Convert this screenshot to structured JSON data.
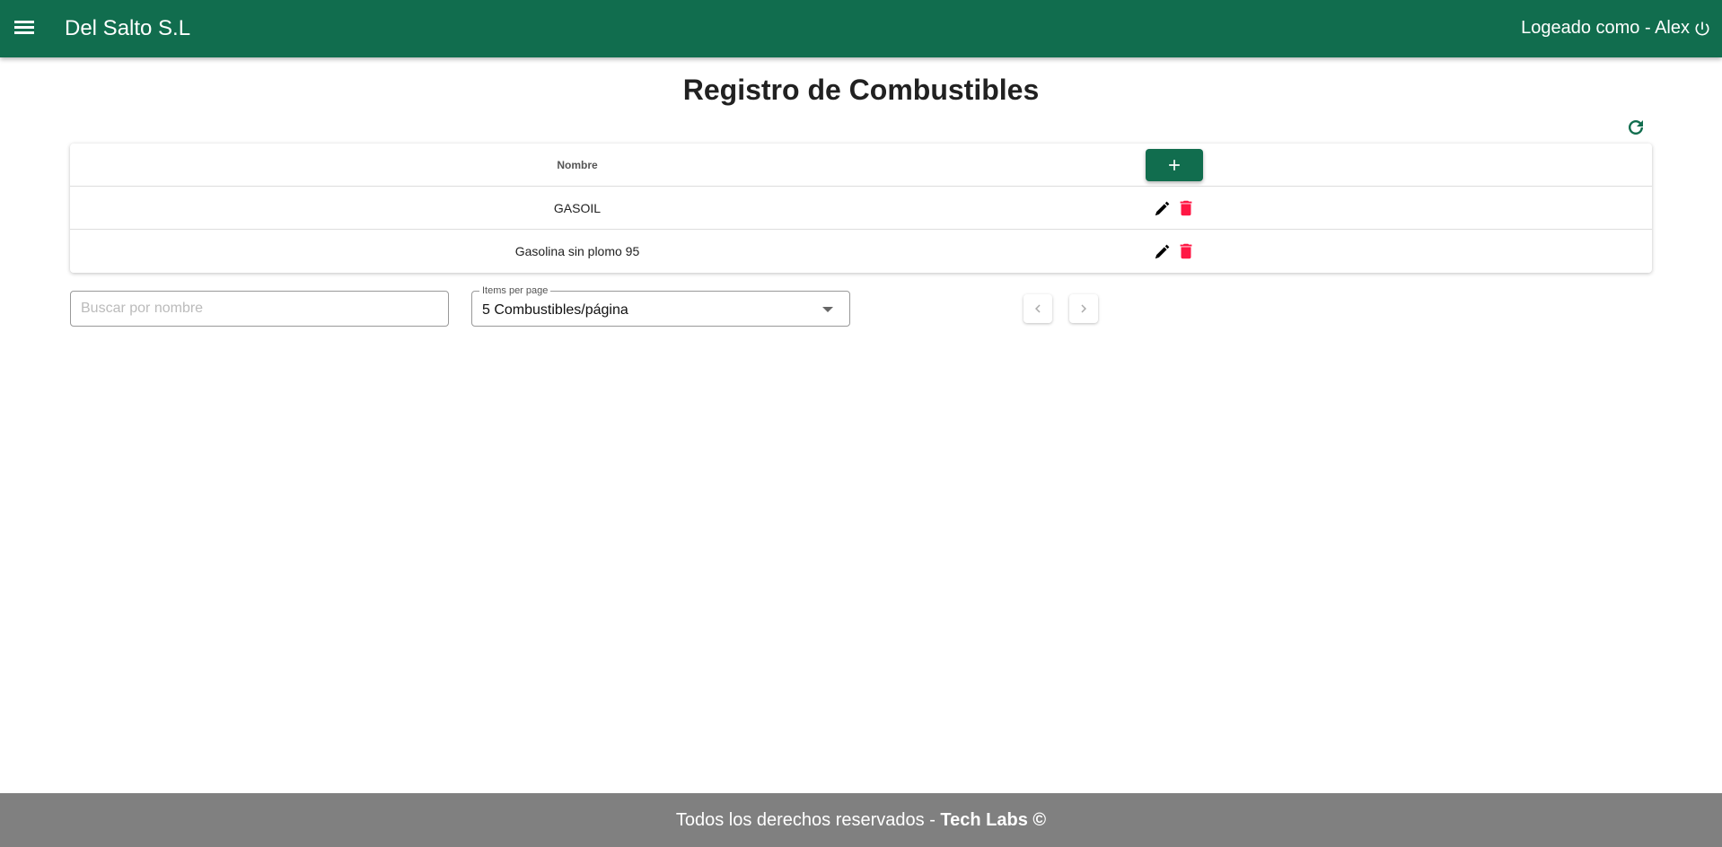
{
  "header": {
    "brand": "Del Salto S.L",
    "user_label": "Logeado como - Alex",
    "menu_icon": "menu-icon",
    "logout_icon": "power-icon"
  },
  "page": {
    "title": "Registro de Combustibles"
  },
  "table": {
    "columns": [
      "Nombre"
    ],
    "rows": [
      {
        "nombre": "GASOIL"
      },
      {
        "nombre": "Gasolina sin plomo 95"
      }
    ]
  },
  "search": {
    "placeholder": "Buscar por nombre",
    "value": ""
  },
  "items_per_page": {
    "label": "Items per page",
    "value": "5 Combustibles/página"
  },
  "footer": {
    "text": "Todos los derechos reservados - ",
    "brand": "Tech Labs ©"
  },
  "colors": {
    "primary": "#116d4e",
    "delete": "#ff1744",
    "footer": "#808080"
  }
}
